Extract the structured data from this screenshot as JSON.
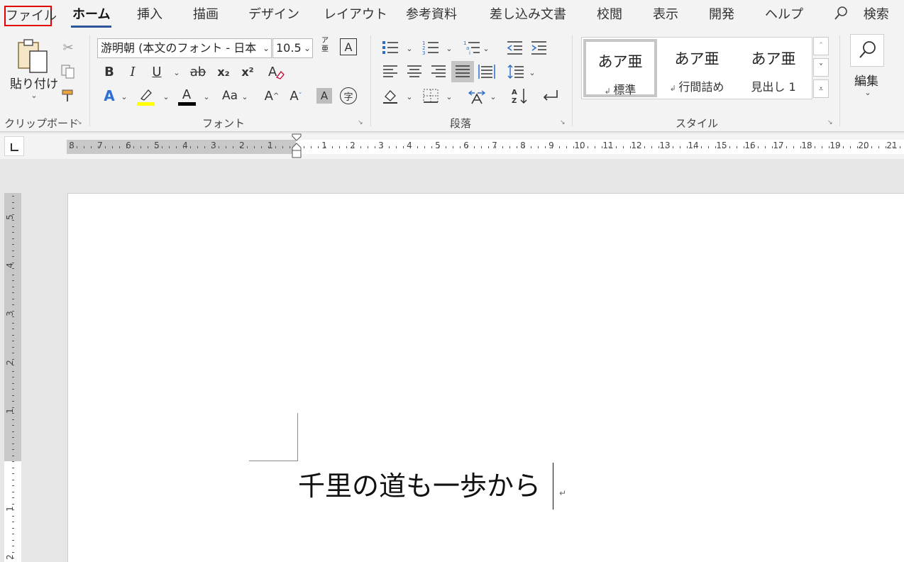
{
  "tabs": [
    "ファイル",
    "ホーム",
    "挿入",
    "描画",
    "デザイン",
    "レイアウト",
    "参考資料",
    "差し込み文書",
    "校閲",
    "表示",
    "開発",
    "ヘルプ"
  ],
  "active_tab": "ホーム",
  "search_tab": "検索",
  "clipboard": {
    "paste_label": "貼り付け",
    "group_label": "クリップボード"
  },
  "font": {
    "font_name": "游明朝 (本文のフォント - 日本",
    "font_size": "10.5",
    "bold": "B",
    "italic": "I",
    "underline": "U",
    "strike": "ab",
    "subscript": "x₂",
    "superscript": "x²",
    "text_effect": "A",
    "font_color": "A",
    "change_case": "Aa",
    "grow": "A",
    "shrink": "A",
    "char_shading": "A",
    "enclose": "字",
    "phonetic": "ア亜",
    "border": "A",
    "highlight_color": "#ffff00",
    "font_color_value": "#000000",
    "group_label": "フォント"
  },
  "paragraph": {
    "group_label": "段落"
  },
  "styles": {
    "items": [
      {
        "preview": "あア亜",
        "label": "標準"
      },
      {
        "preview": "あア亜",
        "label": "行間詰め"
      },
      {
        "preview": "あア亜",
        "label": "見出し 1"
      }
    ],
    "group_label": "スタイル"
  },
  "editing": {
    "label": "編集"
  },
  "ruler": {
    "h_left_numbers": [
      "8",
      "7",
      "6",
      "5",
      "4",
      "3",
      "2",
      "1"
    ],
    "h_right_numbers": [
      "1",
      "2",
      "3",
      "4",
      "5",
      "6",
      "7",
      "8",
      "9",
      "10",
      "11",
      "12",
      "13",
      "14",
      "15",
      "16",
      "17",
      "18",
      "19",
      "20",
      "21"
    ],
    "v_numbers": [
      "5",
      "4",
      "3",
      "2",
      "1",
      "1",
      "2"
    ]
  },
  "document": {
    "text": "千里の道も一歩から",
    "para_mark": "↵"
  },
  "colors": {
    "accent": "#2b579a",
    "file_highlight": "#e00000"
  }
}
